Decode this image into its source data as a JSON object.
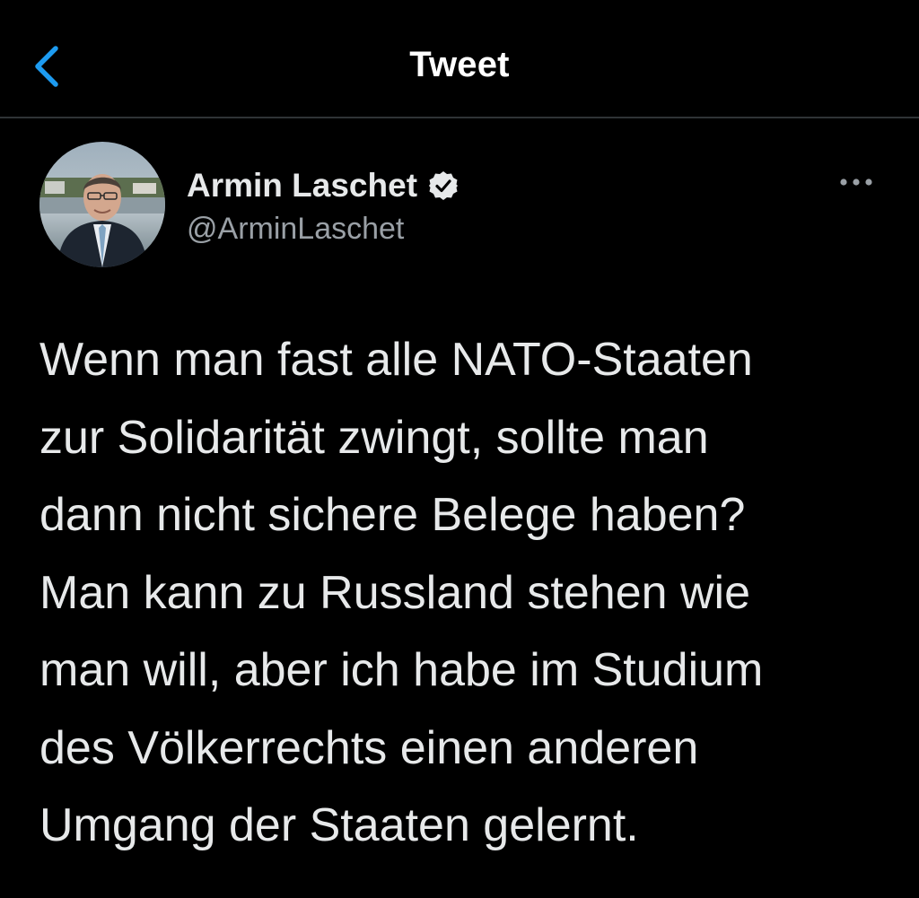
{
  "header": {
    "title": "Tweet",
    "back_icon": "chevron-left-icon",
    "accent_color": "#1d9bf0"
  },
  "author": {
    "display_name": "Armin Laschet",
    "handle": "@ArminLaschet",
    "verified": true,
    "verified_icon": "verified-badge-icon",
    "more_icon": "more-horizontal-icon"
  },
  "tweet": {
    "lines": [
      "Wenn man fast alle NATO-Staaten",
      "zur Solidarität zwingt, sollte man",
      "dann nicht sichere Belege haben?",
      "Man kann zu Russland stehen wie",
      "man will, aber ich habe im Studium",
      "des Völkerrechts einen anderen",
      "Umgang der Staaten gelernt."
    ]
  }
}
